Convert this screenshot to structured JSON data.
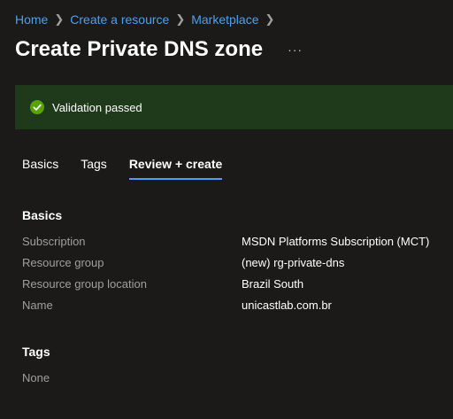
{
  "breadcrumb": {
    "items": [
      "Home",
      "Create a resource",
      "Marketplace"
    ]
  },
  "header": {
    "title": "Create Private DNS zone",
    "more_label": "···"
  },
  "banner": {
    "text": "Validation passed",
    "status_color": "#57a300"
  },
  "tabs": [
    {
      "label": "Basics",
      "active": false
    },
    {
      "label": "Tags",
      "active": false
    },
    {
      "label": "Review + create",
      "active": true
    }
  ],
  "basics": {
    "heading": "Basics",
    "rows": [
      {
        "label": "Subscription",
        "value": "MSDN Platforms Subscription (MCT)"
      },
      {
        "label": "Resource group",
        "value": "(new) rg-private-dns"
      },
      {
        "label": "Resource group location",
        "value": "Brazil South"
      },
      {
        "label": "Name",
        "value": "unicastlab.com.br"
      }
    ]
  },
  "tags": {
    "heading": "Tags",
    "value": "None"
  }
}
